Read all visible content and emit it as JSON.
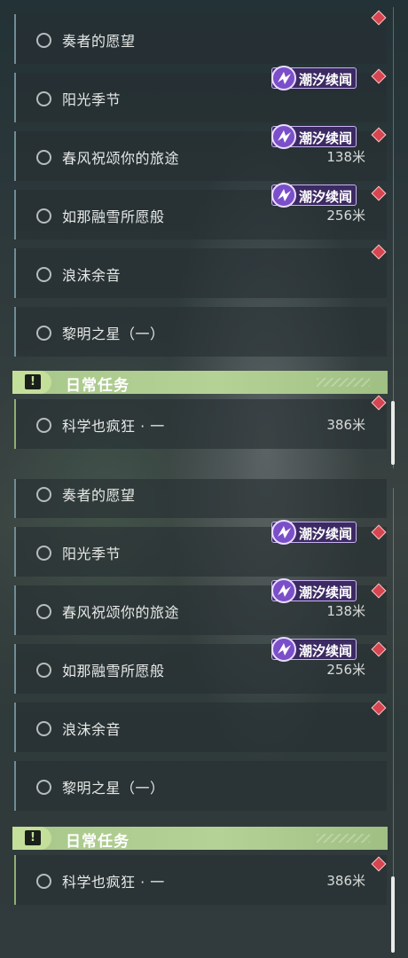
{
  "quests": {
    "q1": {
      "label": "奏者的愿望"
    },
    "q2": {
      "label": "阳光季节"
    },
    "q3": {
      "label": "春风祝颂你的旅途",
      "distance": "138米"
    },
    "q4": {
      "label": "如那融雪所愿般",
      "distance": "256米"
    },
    "q5": {
      "label": "浪沫余音"
    },
    "q6": {
      "label": "黎明之星（一）"
    }
  },
  "badge": {
    "label": "潮汐续闻",
    "color": "#3c2a63"
  },
  "daily_section": {
    "title": "日常任务",
    "icon": "exclamation-icon",
    "accent": "#a8c78a"
  },
  "daily_quests": {
    "d1": {
      "label": "科学也疯狂 · 一",
      "distance": "386米"
    }
  },
  "colors": {
    "tracker_marker": "#d64550",
    "quest_bar": "#6f8c95",
    "daily_bar": "#8fae72"
  },
  "icons": [
    "quest-status-circle-icon",
    "tidal-tales-badge-icon",
    "tracker-diamond-icon",
    "exclamation-icon"
  ]
}
